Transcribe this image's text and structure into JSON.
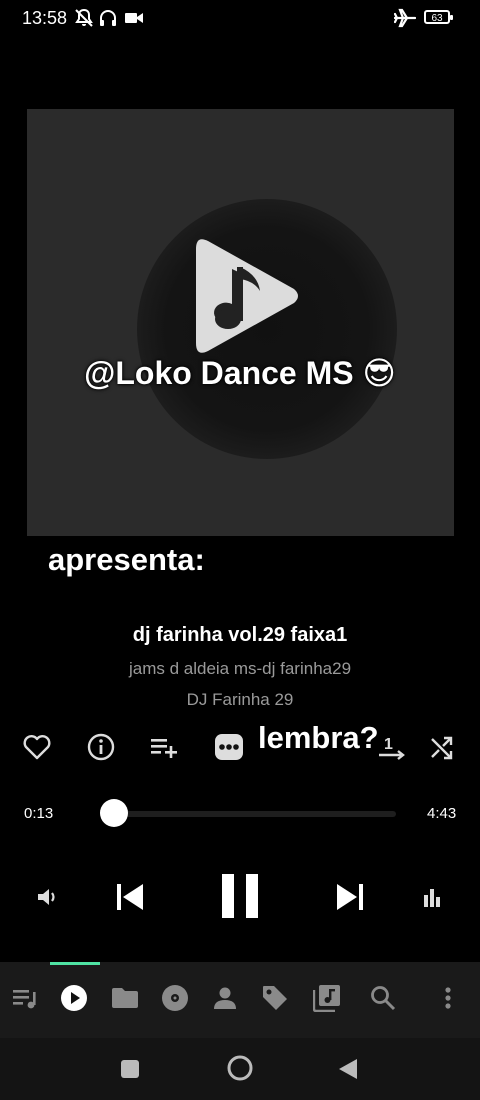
{
  "status_bar": {
    "time": "13:58",
    "battery": "63",
    "left_icons": [
      "muted-bell-icon",
      "headphones-icon",
      "video-camera-icon"
    ],
    "right_icons": [
      "airplane-icon",
      "battery-icon"
    ]
  },
  "artwork": {
    "overlay_brand": "@Loko Dance MS 😎",
    "overlay_apresenta": "apresenta:",
    "overlay_lembra": "lembra?",
    "icon": "play-music-note-icon"
  },
  "track": {
    "title": "dj farinha vol.29 faixa1",
    "album": "jams d aldeia ms-dj farinha29",
    "artist": "DJ Farinha 29"
  },
  "actions": [
    {
      "name": "favorite-heart-icon"
    },
    {
      "name": "info-icon"
    },
    {
      "name": "add-to-playlist-icon"
    },
    {
      "name": "more-options-icon"
    },
    {
      "name": "repeat-one-icon",
      "value": "1"
    },
    {
      "name": "shuffle-icon"
    }
  ],
  "progress": {
    "current": "0:13",
    "total": "4:43",
    "fraction": 0.046
  },
  "transport": [
    "volume-icon",
    "previous-track-icon",
    "pause-icon",
    "next-track-icon",
    "equalizer-icon"
  ],
  "bottom_nav": {
    "active_index": 1,
    "accent": "#4fe3a3",
    "items": [
      "queue-icon",
      "now-playing-icon",
      "folder-icon",
      "album-disc-icon",
      "artist-icon",
      "tag-icon",
      "playlist-icon",
      "search-icon",
      "overflow-menu-icon"
    ]
  },
  "colors": {
    "background": "#000000",
    "artwork": "#2b2b2b",
    "nav_background": "#1a1a1a",
    "muted_text": "#9a9a9a"
  }
}
